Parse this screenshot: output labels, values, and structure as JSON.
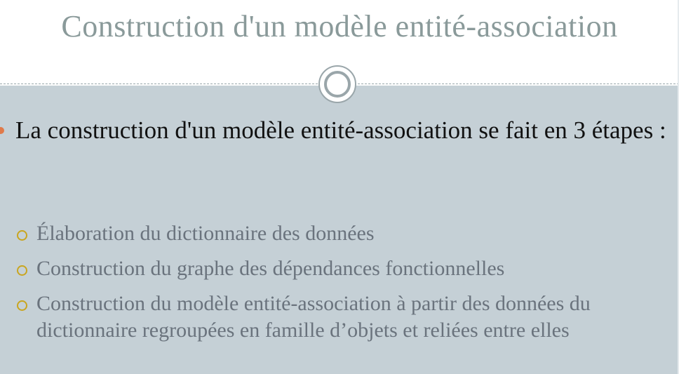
{
  "slide": {
    "title": "Construction d'un modèle entité-association",
    "main_bullet": "La construction d'un modèle entité-association se fait en 3 étapes  :",
    "sub_bullets": [
      "Élaboration du dictionnaire des données",
      "Construction du graphe des dépendances fonctionnelles",
      "Construction du modèle entité-association à partir des données du dictionnaire regroupées en famille d’objets et reliées entre elles"
    ]
  },
  "colors": {
    "title": "#8a9a9a",
    "content_background": "#c5d0d6",
    "main_bullet": "#e07a4a",
    "sub_bullet_ring": "#c9a51f",
    "main_text": "#111111",
    "sub_text": "#6a737d"
  },
  "icons": {
    "divider_ornament": "double-circle-icon",
    "main_bullet": "dot-bullet-icon",
    "sub_bullet": "ring-bullet-icon"
  }
}
